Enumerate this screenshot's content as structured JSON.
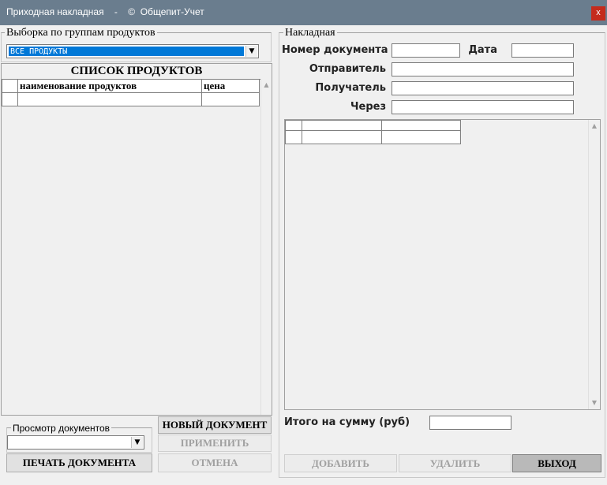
{
  "window": {
    "title": "Приходная накладная    -    ©  Общепит-Учет",
    "close_label": "x"
  },
  "filter": {
    "group_label": "Выборка по группам продуктов",
    "selected": "ВСЕ ПРОДУКТЫ",
    "dropdown_glyph": "▼"
  },
  "products": {
    "caption": "СПИСОК ПРОДУКТОВ",
    "columns": [
      "наименование продуктов",
      "цена"
    ],
    "scroll_up": "▲"
  },
  "docs_view": {
    "group_label": "Просмотр документов",
    "selected": "",
    "dropdown_glyph": "▼"
  },
  "left_buttons": {
    "print": "ПЕЧАТЬ ДОКУМЕНТА",
    "new_doc": "НОВЫЙ  ДОКУМЕНТ",
    "apply": "ПРИМЕНИТЬ",
    "cancel": "ОТМЕНА"
  },
  "invoice": {
    "group_label": "Накладная",
    "doc_number_label": "Номер документа",
    "doc_number_value": "",
    "date_label": "Дата",
    "date_value": "",
    "sender_label": "Отправитель",
    "sender_value": "",
    "receiver_label": "Получатель",
    "receiver_value": "",
    "via_label": "Через",
    "via_value": "",
    "scroll_up": "▲",
    "scroll_down": "▼",
    "total_label": "Итого на сумму (руб)",
    "total_value": ""
  },
  "right_buttons": {
    "add": "ДОБАВИТЬ",
    "delete": "УДАЛИТЬ",
    "exit": "ВЫХОД"
  }
}
